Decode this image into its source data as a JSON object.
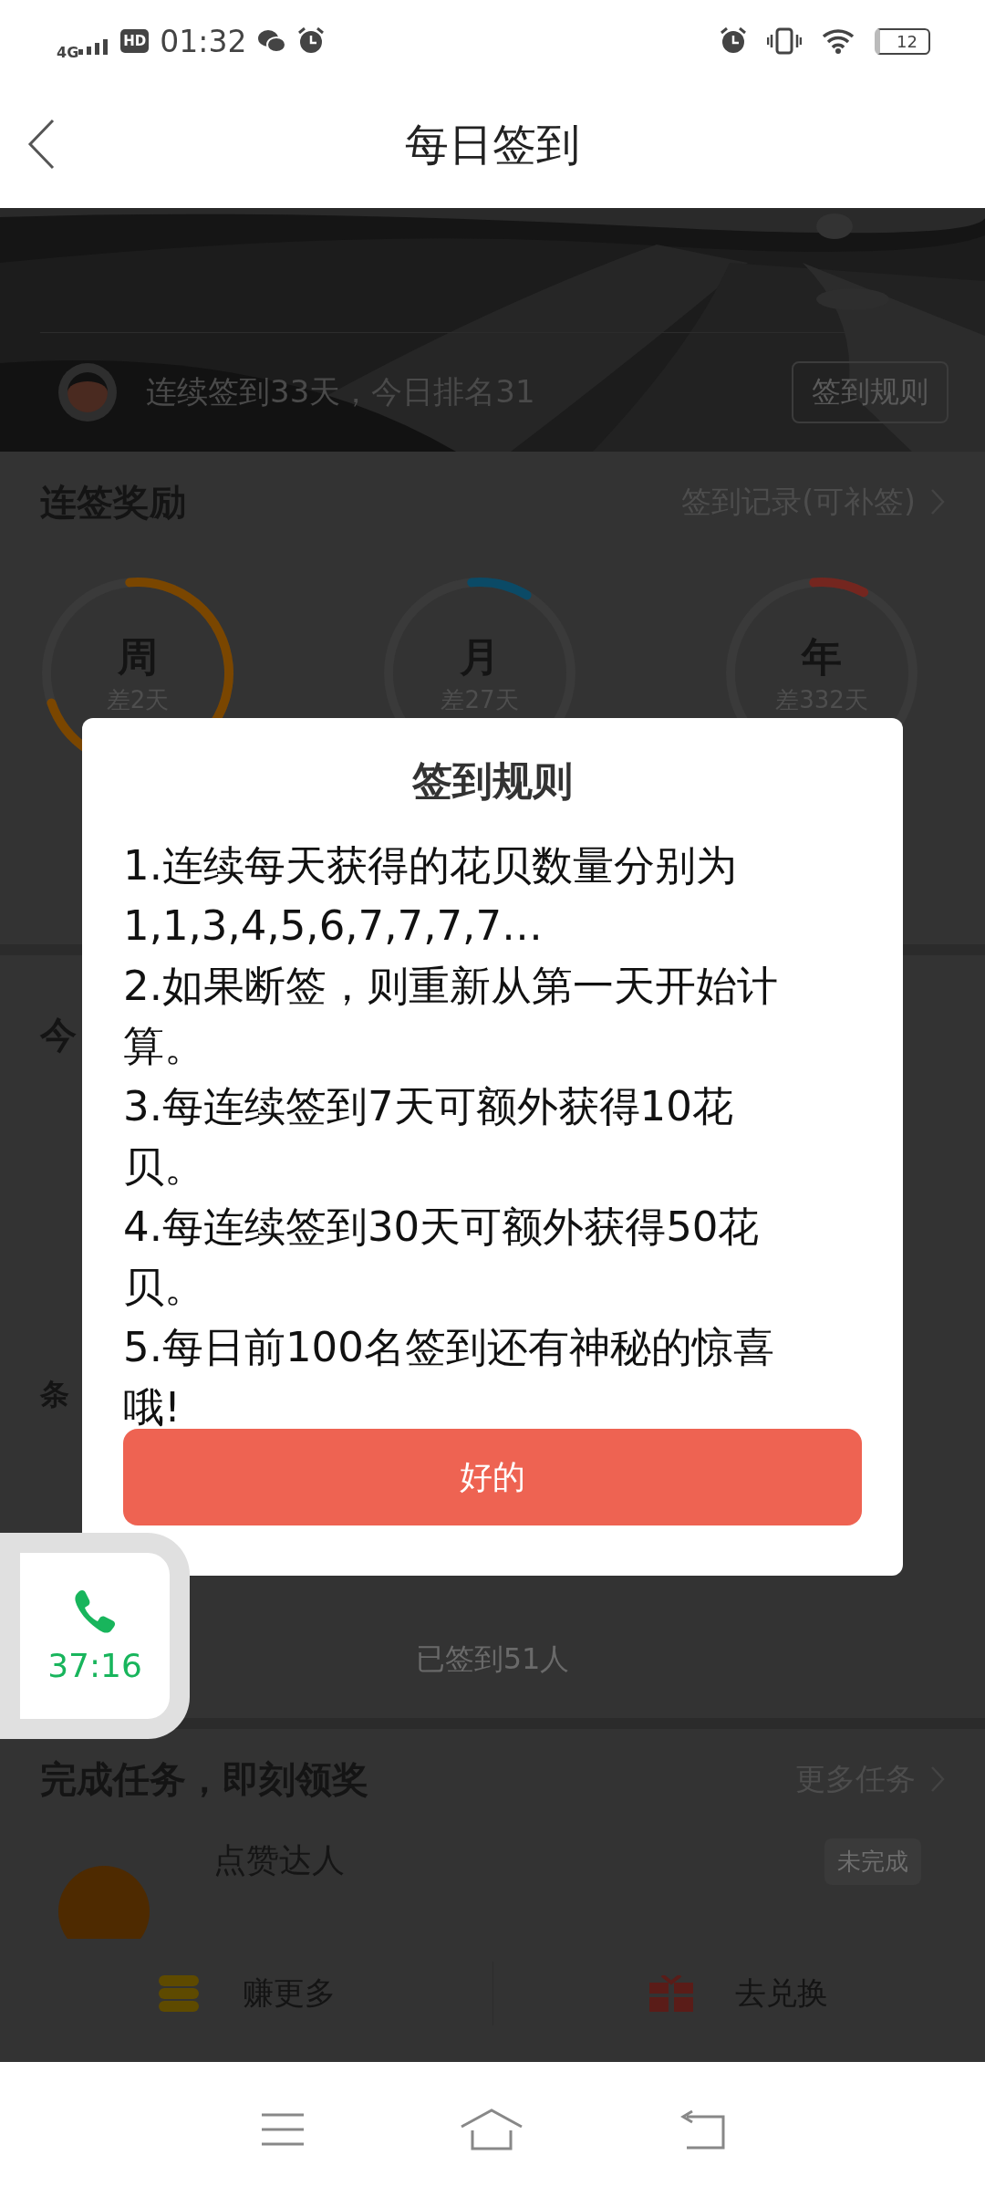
{
  "status_bar": {
    "network": "4G",
    "hd": "HD",
    "time": "01:32",
    "battery": "12"
  },
  "header": {
    "title": "每日签到"
  },
  "banner": {
    "kind": "picture",
    "streak_text": "连续签到33天，今日排名31",
    "rules_button": "签到规则"
  },
  "streak_rewards": {
    "title": "连签奖励",
    "link": "签到记录(可补签)",
    "rings": [
      {
        "label": "周",
        "remaining": "差2天",
        "color": "#7a4600"
      },
      {
        "label": "月",
        "remaining": "差27天",
        "color": "#0b4a66"
      },
      {
        "label": "年",
        "remaining": "差332天",
        "color": "#74261f"
      }
    ]
  },
  "today_section": {
    "title": "今"
  },
  "card": {
    "title": "条"
  },
  "signed_count": "已签到51人",
  "tasks": {
    "title": "完成任务，即刻领奖",
    "link": "更多任务",
    "items": [
      {
        "name": "点赞达人",
        "status": "未完成"
      }
    ]
  },
  "bottom_actions": [
    {
      "kind": "coins",
      "label": "赚更多"
    },
    {
      "kind": "gift",
      "label": "去兑换"
    }
  ],
  "dialog": {
    "title": "签到规则",
    "rules": [
      "1.连续每天获得的花贝数量分别为1,1,3,4,5,6,7,7,7,7…",
      "2.如果断签，则重新从第一天开始计算。",
      "3.每连续签到7天可额外获得10花贝。",
      "4.每连续签到30天可额外获得50花贝。",
      "5.每日前100名签到还有神秘的惊喜哦!"
    ],
    "button": "好的"
  },
  "call_bubble": {
    "duration": "37:16"
  }
}
